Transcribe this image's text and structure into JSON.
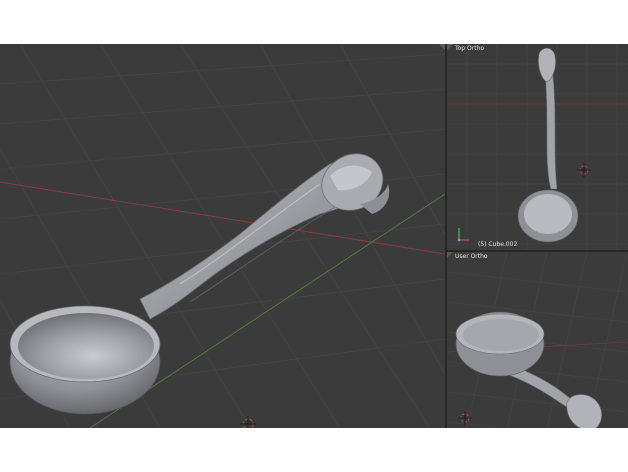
{
  "viewports": {
    "top": {
      "label": "Top Ortho",
      "status": "(5) Cube.002"
    },
    "user": {
      "label": "User Ortho"
    }
  },
  "colors": {
    "background": "#3b3b3b",
    "grid": "#454545",
    "axis_x": "#8a3b3b",
    "axis_y": "#4e7a3b",
    "mesh": "#a7a9ae",
    "separator": "#262626"
  },
  "icons": [
    "cursor-3d-icon",
    "axis-gizmo-icon",
    "viewport-corner-icon"
  ]
}
